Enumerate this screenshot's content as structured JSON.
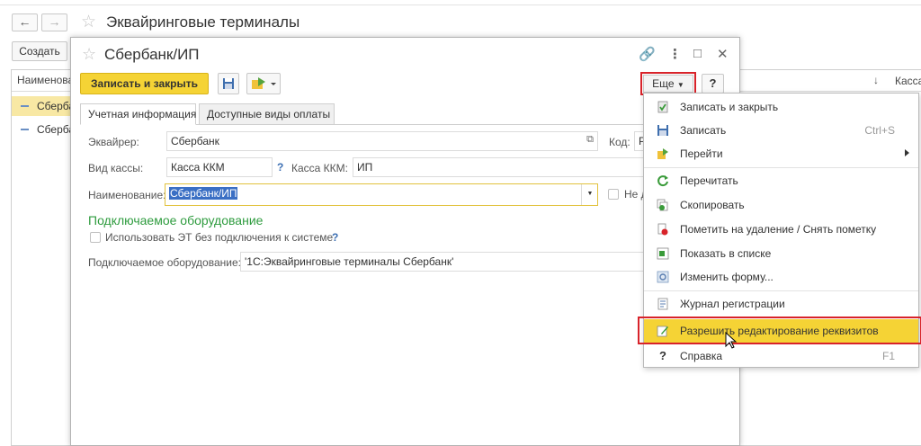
{
  "background": {
    "title": "Эквайринговые терминалы",
    "nav_back": "←",
    "nav_forward": "→",
    "create_label": "Создать",
    "list_header": "Наименование",
    "list_rows": [
      "Сбербанк/ИП",
      "Сбербанк"
    ],
    "right_panel": {
      "sort_icon": "↓",
      "header": "Касса"
    }
  },
  "modal": {
    "title": "Сбербанк/ИП",
    "controls": {
      "link": "🔗",
      "more": "⋮",
      "maximize": "□",
      "close": "✕"
    },
    "save_close_label": "Записать и закрыть",
    "more_label": "Еще",
    "help_label": "?",
    "tabs": [
      {
        "label": "Учетная информация",
        "active": true
      },
      {
        "label": "Доступные виды оплаты",
        "active": false
      }
    ],
    "fields": {
      "acquirer_label": "Эквайрер:",
      "acquirer_value": "Сбербанк",
      "code_label": "Код:",
      "code_value": "Р",
      "cash_type_label": "Вид кассы:",
      "cash_type_value": "Касса ККМ",
      "cash_kkm_label": "Касса ККМ:",
      "cash_kkm_value": "ИП",
      "name_label": "Наименование:",
      "name_value": "Сбербанк/ИП",
      "not_label": "Не д"
    },
    "equipment": {
      "section_title": "Подключаемое оборудование",
      "checkbox_label": "Использовать ЭТ без подключения к системе",
      "equipment_label": "Подключаемое оборудование:",
      "equipment_value": "'1С:Эквайринговые терминалы Сбербанк'"
    }
  },
  "menu": {
    "items": [
      {
        "label": "Записать и закрыть",
        "icon": "save-close-icon",
        "shortcut": ""
      },
      {
        "label": "Записать",
        "icon": "save-icon",
        "shortcut": "Ctrl+S"
      },
      {
        "label": "Перейти",
        "icon": "go-to-icon",
        "shortcut": "",
        "submenu": true
      },
      {
        "label": "Перечитать",
        "icon": "reread-icon",
        "shortcut": ""
      },
      {
        "label": "Скопировать",
        "icon": "copy-icon",
        "shortcut": ""
      },
      {
        "label": "Пометить на удаление / Снять пометку",
        "icon": "mark-delete-icon",
        "shortcut": ""
      },
      {
        "label": "Показать в списке",
        "icon": "show-in-list-icon",
        "shortcut": ""
      },
      {
        "label": "Изменить форму...",
        "icon": "change-form-icon",
        "shortcut": ""
      },
      {
        "label": "Журнал регистрации",
        "icon": "event-log-icon",
        "shortcut": ""
      },
      {
        "label": "Разрешить редактирование реквизитов",
        "icon": "allow-edit-icon",
        "shortcut": "",
        "highlighted": true
      },
      {
        "label": "Справка",
        "icon": "help-icon",
        "shortcut": "F1"
      }
    ]
  },
  "colors": {
    "accent_yellow": "#f5d335",
    "highlight_red": "#d8232a",
    "section_green": "#2f9c3f",
    "link_blue": "#3c6fb3"
  }
}
